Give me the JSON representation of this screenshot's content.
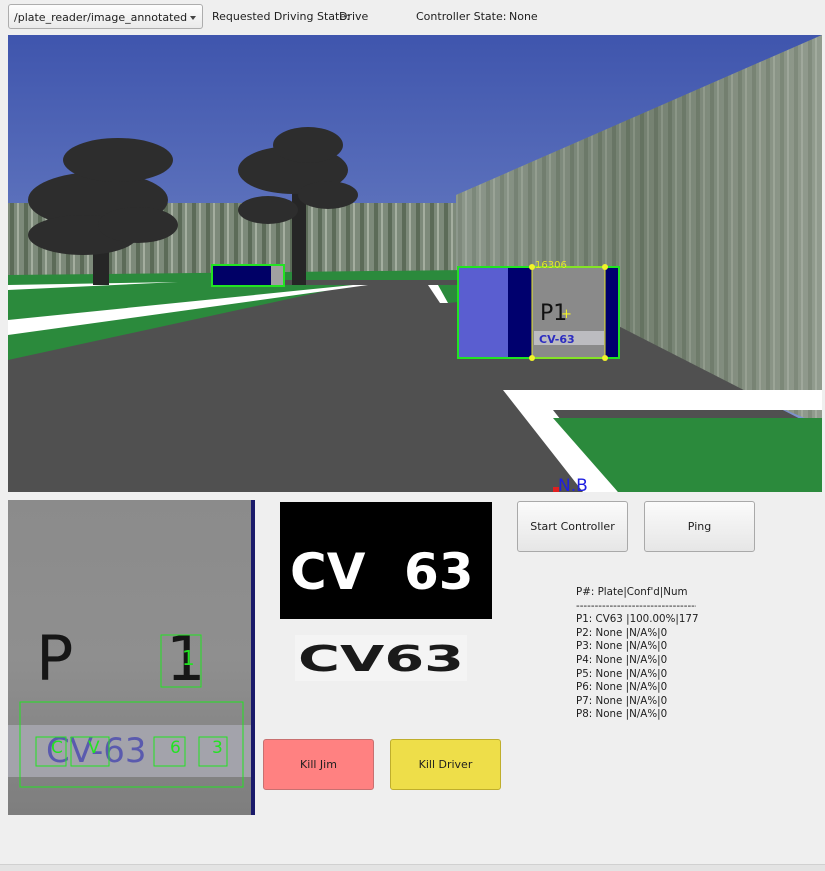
{
  "topbar": {
    "topic": "/plate_reader/image_annotated",
    "driving_state_label": "Requested Driving State:",
    "driving_state_value": "Drive",
    "controller_state_label": "Controller State:",
    "controller_state_value": "None"
  },
  "camera": {
    "car_id": "16306",
    "plate_sign_label": "P1",
    "plate_sign_plate": "CV-63",
    "heading_label": "N.B"
  },
  "crop": {
    "parking_text": "P",
    "digit": "1",
    "plate_chars": [
      "C",
      "V",
      "6",
      "3"
    ],
    "plate_text": "CV-63"
  },
  "binary": {
    "text_left": "CV",
    "text_right": "63",
    "strip_text": "CV63"
  },
  "buttons": {
    "start_controller": "Start Controller",
    "ping": "Ping",
    "kill_jim": "Kill Jim",
    "kill_driver": "Kill Driver"
  },
  "results": {
    "header": "P#: Plate|Conf'd|Num",
    "divider": "-----------------------------------",
    "rows": [
      "P1: CV63 |100.00%|177",
      "P2: None |N/A%|0",
      "P3: None |N/A%|0",
      "P4: None |N/A%|0",
      "P5: None |N/A%|0",
      "P6: None |N/A%|0",
      "P7: None |N/A%|0",
      "P8: None |N/A%|0"
    ]
  },
  "colors": {
    "detect_box": "#22e322",
    "plate_blue": "#00006e",
    "grass": "#2b8a3c",
    "road": "#505050",
    "kill_jim": "#ff8181",
    "kill_driver": "#eede49"
  }
}
